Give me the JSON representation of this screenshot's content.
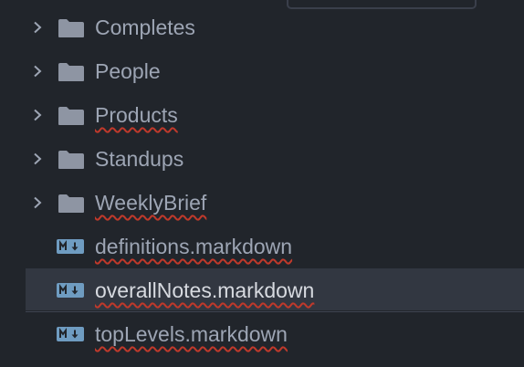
{
  "file_tree": {
    "items": [
      {
        "type": "folder",
        "label": "Completes",
        "misspelled": false,
        "selected": false
      },
      {
        "type": "folder",
        "label": "People",
        "misspelled": false,
        "selected": false
      },
      {
        "type": "folder",
        "label": "Products",
        "misspelled": true,
        "selected": false
      },
      {
        "type": "folder",
        "label": "Standups",
        "misspelled": false,
        "selected": false
      },
      {
        "type": "folder",
        "label": "WeeklyBrief",
        "misspelled": true,
        "selected": false
      },
      {
        "type": "markdown",
        "label": "definitions.markdown",
        "misspelled": true,
        "selected": false
      },
      {
        "type": "markdown",
        "label": "overallNotes.markdown",
        "misspelled": true,
        "selected": true
      },
      {
        "type": "markdown",
        "label": "topLevels.markdown",
        "misspelled": true,
        "selected": false
      }
    ]
  },
  "colors": {
    "background": "#21252b",
    "text": "#9da5b4",
    "selected_text": "#d7dae0",
    "selected_background": "#323741",
    "folder_icon": "#8e95a3",
    "markdown_icon": "#6f9cc1",
    "spellcheck_underline": "#c0392b"
  },
  "icons": {
    "folder": "folder-icon",
    "markdown": "markdown-file-icon",
    "expand": "chevron-right-icon"
  }
}
